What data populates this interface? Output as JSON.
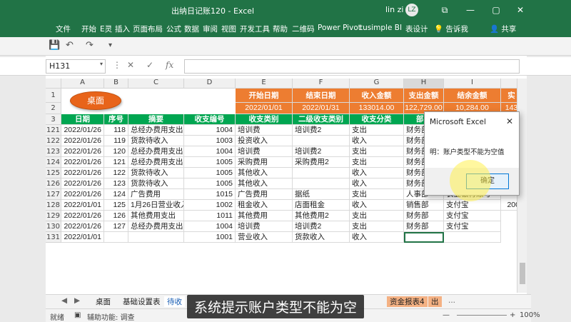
{
  "window": {
    "title": "出纳日记账120  -  Excel",
    "user": "lin zi",
    "avatar": "LZ",
    "min": "—",
    "restore": "▢",
    "close": "✕",
    "ribbon_opts": "⧉"
  },
  "ribbon_tabs": [
    "文件",
    "开始",
    "E灵",
    "插入",
    "页面布局",
    "公式",
    "数据",
    "审阅",
    "视图",
    "开发工具",
    "帮助",
    "二维码",
    "Power Pivot",
    "tusimple BI",
    "表设计",
    "告诉我",
    "共享"
  ],
  "qat": {
    "save": "💾",
    "undo": "↶",
    "redo": "↷",
    "more": "▾"
  },
  "formula_bar": {
    "name_box": "H131",
    "name_dd": "▾",
    "cancel": "✕",
    "enter": "✓",
    "fx": "fx",
    "value": ""
  },
  "columns": [
    "A",
    "B",
    "C",
    "D",
    "E",
    "F",
    "G",
    "H",
    "I"
  ],
  "summary": {
    "headers": [
      "开始日期",
      "结束日期",
      "收入金额",
      "支出金额",
      "结余金额",
      "实"
    ],
    "values": [
      "2022/01/01",
      "2022/01/31",
      "133014.00",
      "122,729.00",
      "10,284.00",
      "143"
    ]
  },
  "desktop_button": "桌面",
  "table_headers": [
    "日期",
    "序号",
    "摘要",
    "收支编号",
    "收支类别",
    "二级收支类别",
    "收支分类",
    "部门",
    ""
  ],
  "rows": [
    {
      "rn": "121",
      "date": "2022/01/26",
      "seq": "118",
      "desc": "总经办费用支出",
      "code": "1004",
      "cat": "培训费",
      "sub": "培训费2",
      "type": "支出",
      "dept": "财务部",
      "extra": ""
    },
    {
      "rn": "122",
      "date": "2022/01/26",
      "seq": "119",
      "desc": "货款待收入",
      "code": "1003",
      "cat": "投资收入",
      "sub": "",
      "type": "收入",
      "dept": "财务部",
      "extra": ""
    },
    {
      "rn": "123",
      "date": "2022/01/26",
      "seq": "120",
      "desc": "总经办费用支出",
      "code": "1004",
      "cat": "培训费",
      "sub": "培训费2",
      "type": "支出",
      "dept": "财务部",
      "extra": ""
    },
    {
      "rn": "124",
      "date": "2022/01/26",
      "seq": "121",
      "desc": "总经办费用支出",
      "code": "1005",
      "cat": "采购费用",
      "sub": "采购费用2",
      "type": "支出",
      "dept": "财务部",
      "extra": ""
    },
    {
      "rn": "125",
      "date": "2022/01/26",
      "seq": "122",
      "desc": "货款待收入",
      "code": "1005",
      "cat": "其他收入",
      "sub": "",
      "type": "收入",
      "dept": "财务部",
      "extra": ""
    },
    {
      "rn": "126",
      "date": "2022/01/26",
      "seq": "123",
      "desc": "货款待收入",
      "code": "1005",
      "cat": "其他收入",
      "sub": "",
      "type": "收入",
      "dept": "财务部",
      "extra": ""
    },
    {
      "rn": "127",
      "date": "2022/01/26",
      "seq": "124",
      "desc": "广告费用",
      "code": "1015",
      "cat": "广告费用",
      "sub": "据纸",
      "type": "支出",
      "dept": "人事部",
      "extra": "农业银行账号"
    },
    {
      "rn": "128",
      "date": "2022/01/01",
      "seq": "125",
      "desc": "1月26日营业收入",
      "code": "1002",
      "cat": "租金收入",
      "sub": "店面租金",
      "type": "收入",
      "dept": "销售部",
      "extra": "支付宝"
    },
    {
      "rn": "129",
      "date": "2022/01/26",
      "seq": "126",
      "desc": "其他费用支出",
      "code": "1011",
      "cat": "其他费用",
      "sub": "其他费用2",
      "type": "支出",
      "dept": "财务部",
      "extra": "支付宝"
    },
    {
      "rn": "130",
      "date": "2022/01/26",
      "seq": "127",
      "desc": "总经办费用支出",
      "code": "1004",
      "cat": "培训费",
      "sub": "培训费2",
      "type": "支出",
      "dept": "财务部",
      "extra": "支付宝"
    },
    {
      "rn": "131",
      "date": "2022/01/01",
      "seq": "",
      "desc": "",
      "code": "1001",
      "cat": "营业收入",
      "sub": "货款收入",
      "type": "收入",
      "dept": "",
      "extra": ""
    }
  ],
  "extra_value": "200",
  "dialog": {
    "title": "Microsoft Excel",
    "close": "✕",
    "message": "明：账户类型不能为空值",
    "ok": "确定"
  },
  "sheet_tabs": [
    "桌面",
    "基础设置表",
    "待收",
    "资金报表4",
    "出"
  ],
  "sheet_nav": {
    "prev": "◀",
    "next": "▶",
    "dots": "..."
  },
  "status": {
    "ready": "就绪",
    "accessibility": "辅助功能: 调查",
    "zoom": "100%",
    "minus": "—",
    "plus": "+"
  },
  "caption": "系统提示账户类型不能为空"
}
